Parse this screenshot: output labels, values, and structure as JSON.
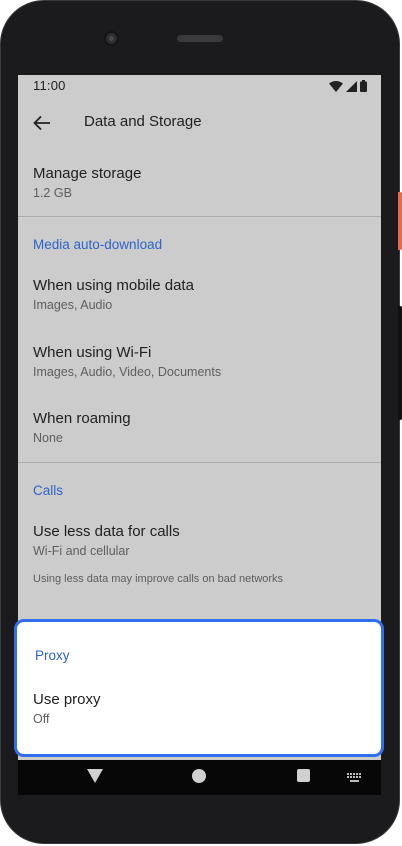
{
  "status_bar": {
    "time": "11:00",
    "icons": [
      "wifi-icon",
      "cellular-signal-icon",
      "battery-icon"
    ]
  },
  "app_bar": {
    "back_icon": "arrow-back-icon",
    "title": "Data and Storage"
  },
  "manage_storage": {
    "title": "Manage storage",
    "subtitle": "1.2 GB"
  },
  "media_auto_download": {
    "header": "Media auto-download",
    "items": [
      {
        "title": "When using mobile data",
        "subtitle": "Images, Audio"
      },
      {
        "title": "When using Wi-Fi",
        "subtitle": "Images, Audio, Video, Documents"
      },
      {
        "title": "When roaming",
        "subtitle": "None"
      }
    ]
  },
  "calls": {
    "header": "Calls",
    "item": {
      "title": "Use less data for calls",
      "subtitle": "Wi-Fi and cellular"
    },
    "footnote": "Using less data may improve calls on bad networks"
  },
  "proxy": {
    "header": "Proxy",
    "item": {
      "title": "Use proxy",
      "subtitle": "Off"
    }
  },
  "nav_bar": {
    "icons": [
      "nav-back-icon",
      "nav-home-icon",
      "nav-recents-icon",
      "keyboard-icon"
    ]
  },
  "colors": {
    "accent": "#2e63c8",
    "highlight_border": "#2f6ff0",
    "screen_bg": "#cccccc"
  }
}
